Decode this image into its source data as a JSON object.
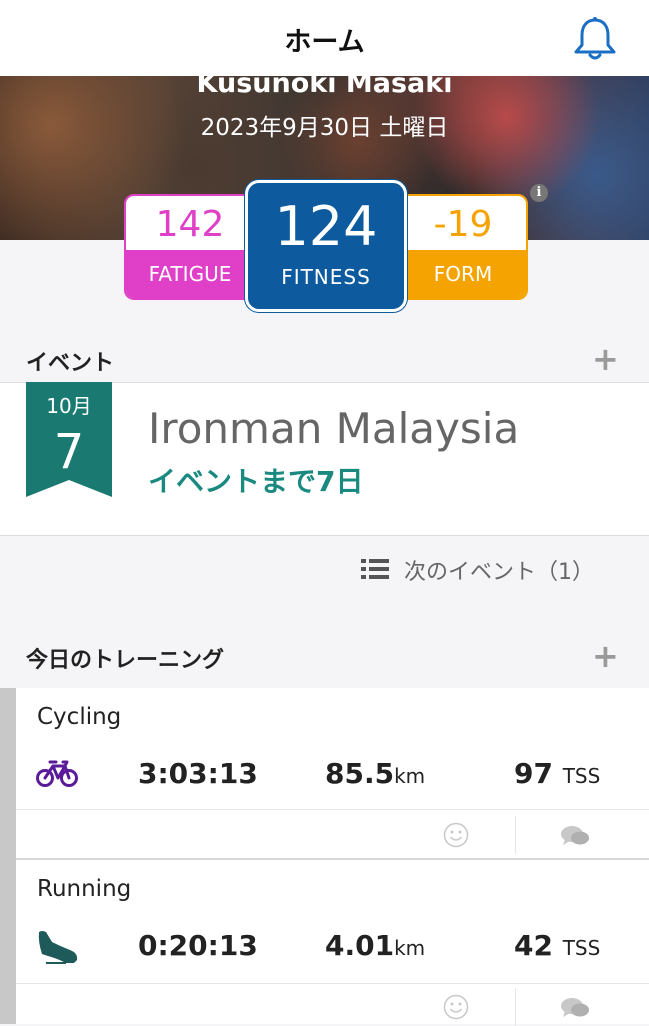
{
  "nav": {
    "title": "ホーム",
    "bell_icon": "bell-icon"
  },
  "header": {
    "athlete_name": "Kusunoki Masaki",
    "date": "2023年9月30日 土曜日"
  },
  "metrics": {
    "fatigue": {
      "value": "142",
      "label": "FATIGUE",
      "color": "#e040c8"
    },
    "fitness": {
      "value": "124",
      "label": "FITNESS",
      "color": "#0d5a9e"
    },
    "form": {
      "value": "-19",
      "label": "FORM",
      "color": "#f5a300"
    },
    "info_icon": "info-icon"
  },
  "events": {
    "section_title": "イベント",
    "add_icon": "plus-icon",
    "event": {
      "month": "10月",
      "day": "7",
      "title": "Ironman Malaysia",
      "countdown": "イベントまで7日",
      "accent": "#1a8a80"
    },
    "next_label": "次のイベント（1）"
  },
  "training": {
    "section_title": "今日のトレーニング",
    "add_icon": "plus-icon",
    "items": [
      {
        "name": "Cycling",
        "icon": "bike-icon",
        "duration": "3:03:13",
        "distance": "85.5",
        "distance_unit": "km",
        "tss": "97",
        "tss_unit": "TSS"
      },
      {
        "name": "Running",
        "icon": "running-shoe-icon",
        "duration": "0:20:13",
        "distance": "4.01",
        "distance_unit": "km",
        "tss": "42",
        "tss_unit": "TSS"
      }
    ]
  }
}
